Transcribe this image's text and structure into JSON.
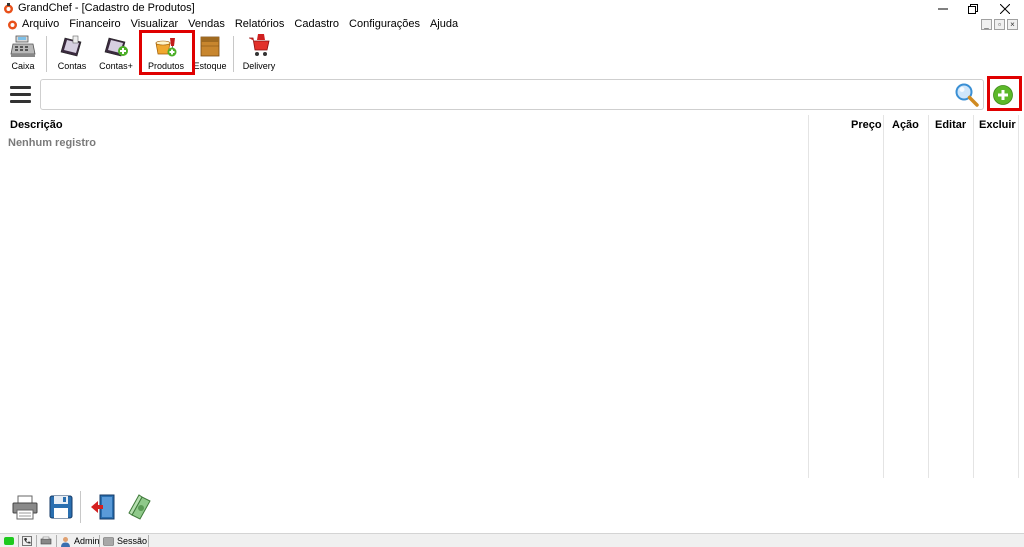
{
  "window": {
    "title": "GrandChef - [Cadastro de Produtos]"
  },
  "menubar": {
    "items": [
      "Arquivo",
      "Financeiro",
      "Visualizar",
      "Vendas",
      "Relatórios",
      "Cadastro",
      "Configurações",
      "Ajuda"
    ],
    "mdi_min": "_",
    "mdi_restore": "▫",
    "mdi_close": "×"
  },
  "toolbar": {
    "caixa": "Caixa",
    "contas": "Contas",
    "contas_plus": "Contas+",
    "produtos": "Produtos",
    "estoque": "Estoque",
    "delivery": "Delivery"
  },
  "search": {
    "value": "",
    "placeholder": ""
  },
  "table": {
    "columns": {
      "descricao": "Descrição",
      "preco": "Preço",
      "acao": "Ação",
      "editar": "Editar",
      "excluir": "Excluir"
    },
    "empty_message": "Nenhum registro"
  },
  "statusbar": {
    "user": "Admin",
    "session": "Sessão"
  },
  "colors": {
    "highlight": "#e00000",
    "add_green": "#5cb82a",
    "status_green": "#1ec91e"
  }
}
